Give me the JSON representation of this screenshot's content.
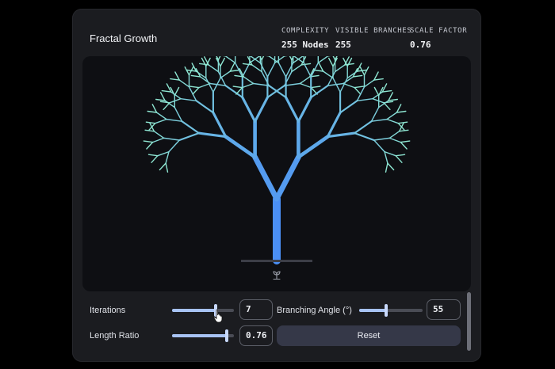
{
  "app": {
    "title": "Fractal Growth"
  },
  "stats": {
    "complexity_label": "COMPLEXITY",
    "complexity_value": "255 Nodes",
    "branches_label": "VISIBLE BRANCHES",
    "branches_value": "255",
    "scale_label": "SCALE FACTOR",
    "scale_value": "0.76"
  },
  "controls": {
    "iterations": {
      "label": "Iterations",
      "value": "7",
      "level": 0.7
    },
    "branching_angle": {
      "label": "Branching Angle (°)",
      "value": "55",
      "level": 0.42
    },
    "length_ratio": {
      "label": "Length Ratio",
      "value": "0.76",
      "level": 0.88
    },
    "reset_label": "Reset"
  },
  "colors": {
    "trunk": "#4a8ff5",
    "tip": "#8ee6d2",
    "slider_fill": "#a8c3f3"
  },
  "icons": {
    "seed": "sprout-icon",
    "cursor": "mouse-pointer-icon"
  }
}
